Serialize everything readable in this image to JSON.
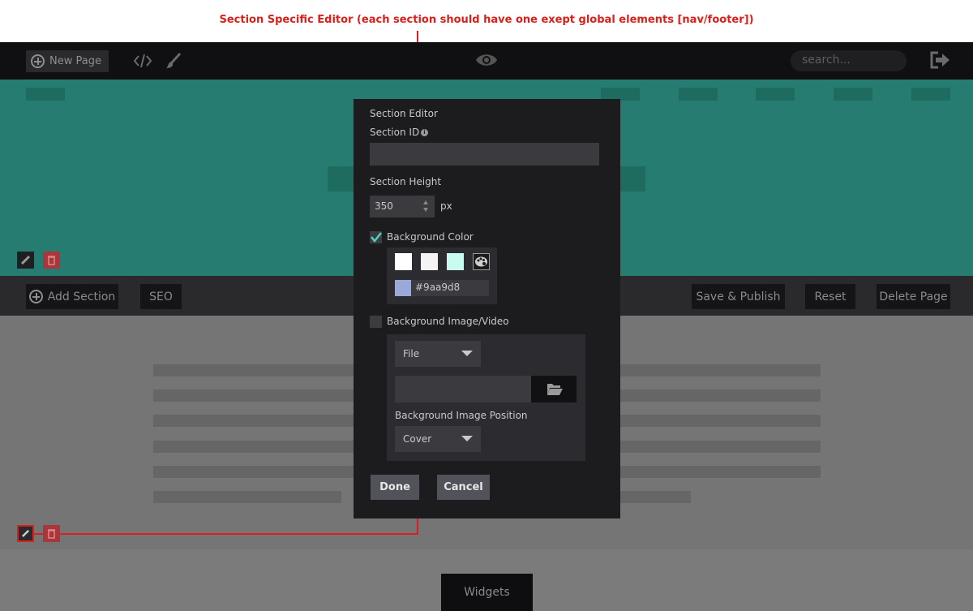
{
  "annotation": {
    "text": "Section Specific Editor (each section should have one exept global elements [nav/footer])"
  },
  "topbar": {
    "new_page_label": "New Page",
    "code_icon": "code-icon",
    "brush_icon": "brush-icon",
    "preview_icon": "eye-icon",
    "search_placeholder": "search...",
    "logout_icon": "logout-icon"
  },
  "toolbar": {
    "add_section_label": "Add Section",
    "seo_label": "SEO",
    "save_publish_label": "Save & Publish",
    "reset_label": "Reset",
    "delete_page_label": "Delete Page"
  },
  "footer": {
    "widgets_label": "Widgets"
  },
  "section_editor": {
    "title": "Section Editor",
    "section_id_label": "Section ID",
    "section_id_value": "",
    "section_height_label": "Section Height",
    "section_height_value": "350",
    "section_height_unit": "px",
    "background_color_label": "Background Color",
    "background_color_checked": true,
    "swatches": [
      "#ffffff",
      "#f4f4f4",
      "#c8fbf1"
    ],
    "custom_color_hex": "#9aa9d8",
    "background_image_label": "Background Image/Video",
    "background_image_checked": false,
    "source_select_value": "File",
    "file_path_value": "",
    "image_position_label": "Background Image Position",
    "image_position_value": "Cover",
    "done_label": "Done",
    "cancel_label": "Cancel"
  },
  "colors": {
    "hero_bg": "#267c70",
    "annotation_red": "#d9201b",
    "delete_red": "#a8363a"
  }
}
